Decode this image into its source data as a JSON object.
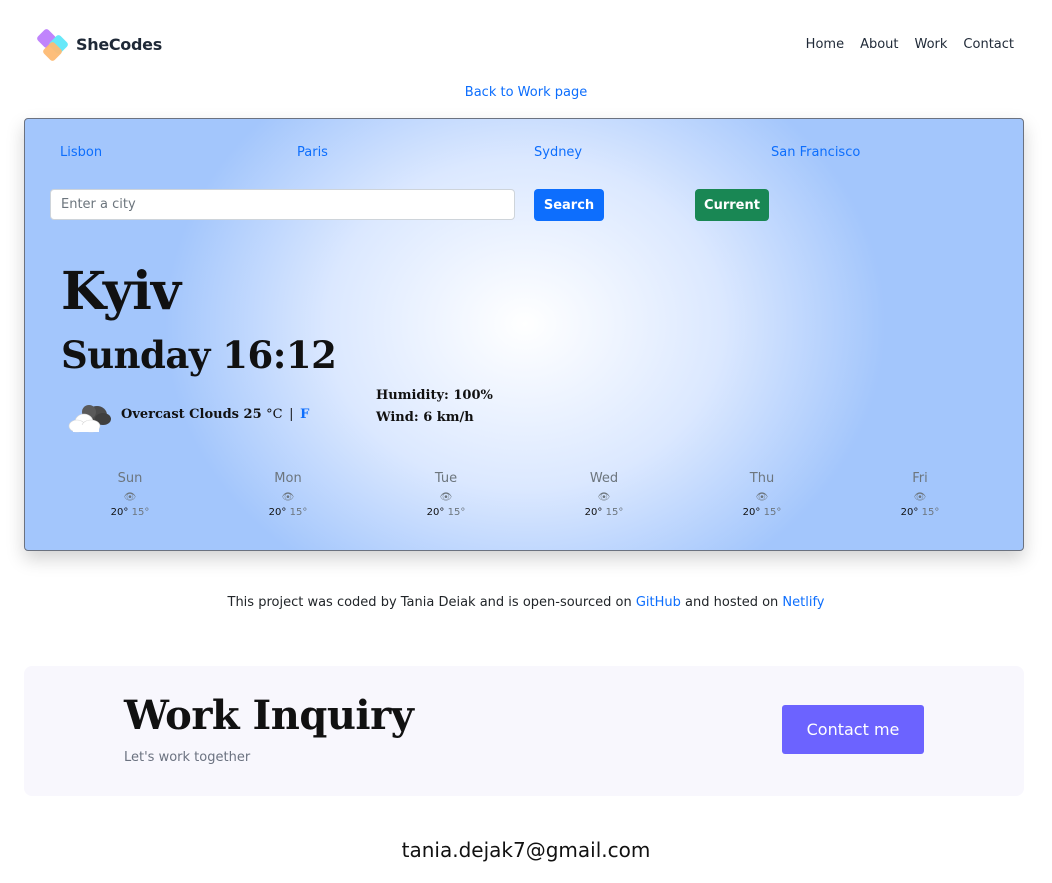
{
  "header": {
    "logo_text": "SheCodes",
    "nav": [
      "Home",
      "About",
      "Work",
      "Contact"
    ]
  },
  "back_link": "Back to Work page",
  "weather": {
    "cities": [
      "Lisbon",
      "Paris",
      "Sydney",
      "San Francisco"
    ],
    "search": {
      "placeholder": "Enter a city",
      "value": ""
    },
    "search_button": "Search",
    "current_button": "Current",
    "city": "Kyiv",
    "day_time": "Sunday 16:12",
    "condition_icon": "overcast-clouds-icon",
    "description": "Overcast Clouds",
    "temperature": "25",
    "unit_c": "°C",
    "separator": "|",
    "unit_f": "F",
    "humidity_label": "Humidity:",
    "humidity_value": "100%",
    "wind_label": "Wind:",
    "wind_value": "6 km/h",
    "forecast": [
      {
        "day": "Sun",
        "icon": "👁",
        "max": "20°",
        "min": "15°"
      },
      {
        "day": "Mon",
        "icon": "👁",
        "max": "20°",
        "min": "15°"
      },
      {
        "day": "Tue",
        "icon": "👁",
        "max": "20°",
        "min": "15°"
      },
      {
        "day": "Wed",
        "icon": "👁",
        "max": "20°",
        "min": "15°"
      },
      {
        "day": "Thu",
        "icon": "👁",
        "max": "20°",
        "min": "15°"
      },
      {
        "day": "Fri",
        "icon": "👁",
        "max": "20°",
        "min": "15°"
      }
    ]
  },
  "footer_note": {
    "prefix": "This project was coded by Tania Deiak and is open-sourced on ",
    "github": "GitHub",
    "middle": " and hosted on ",
    "netlify": "Netlify"
  },
  "inquiry": {
    "title": "Work Inquiry",
    "subtitle": "Let's work together",
    "button": "Contact me"
  },
  "email": "tania.dejak7@gmail.com",
  "colors": {
    "link": "#0d6efd",
    "search_button": "#0d6efd",
    "current_button": "#198754",
    "contact_button": "#6c63ff"
  }
}
